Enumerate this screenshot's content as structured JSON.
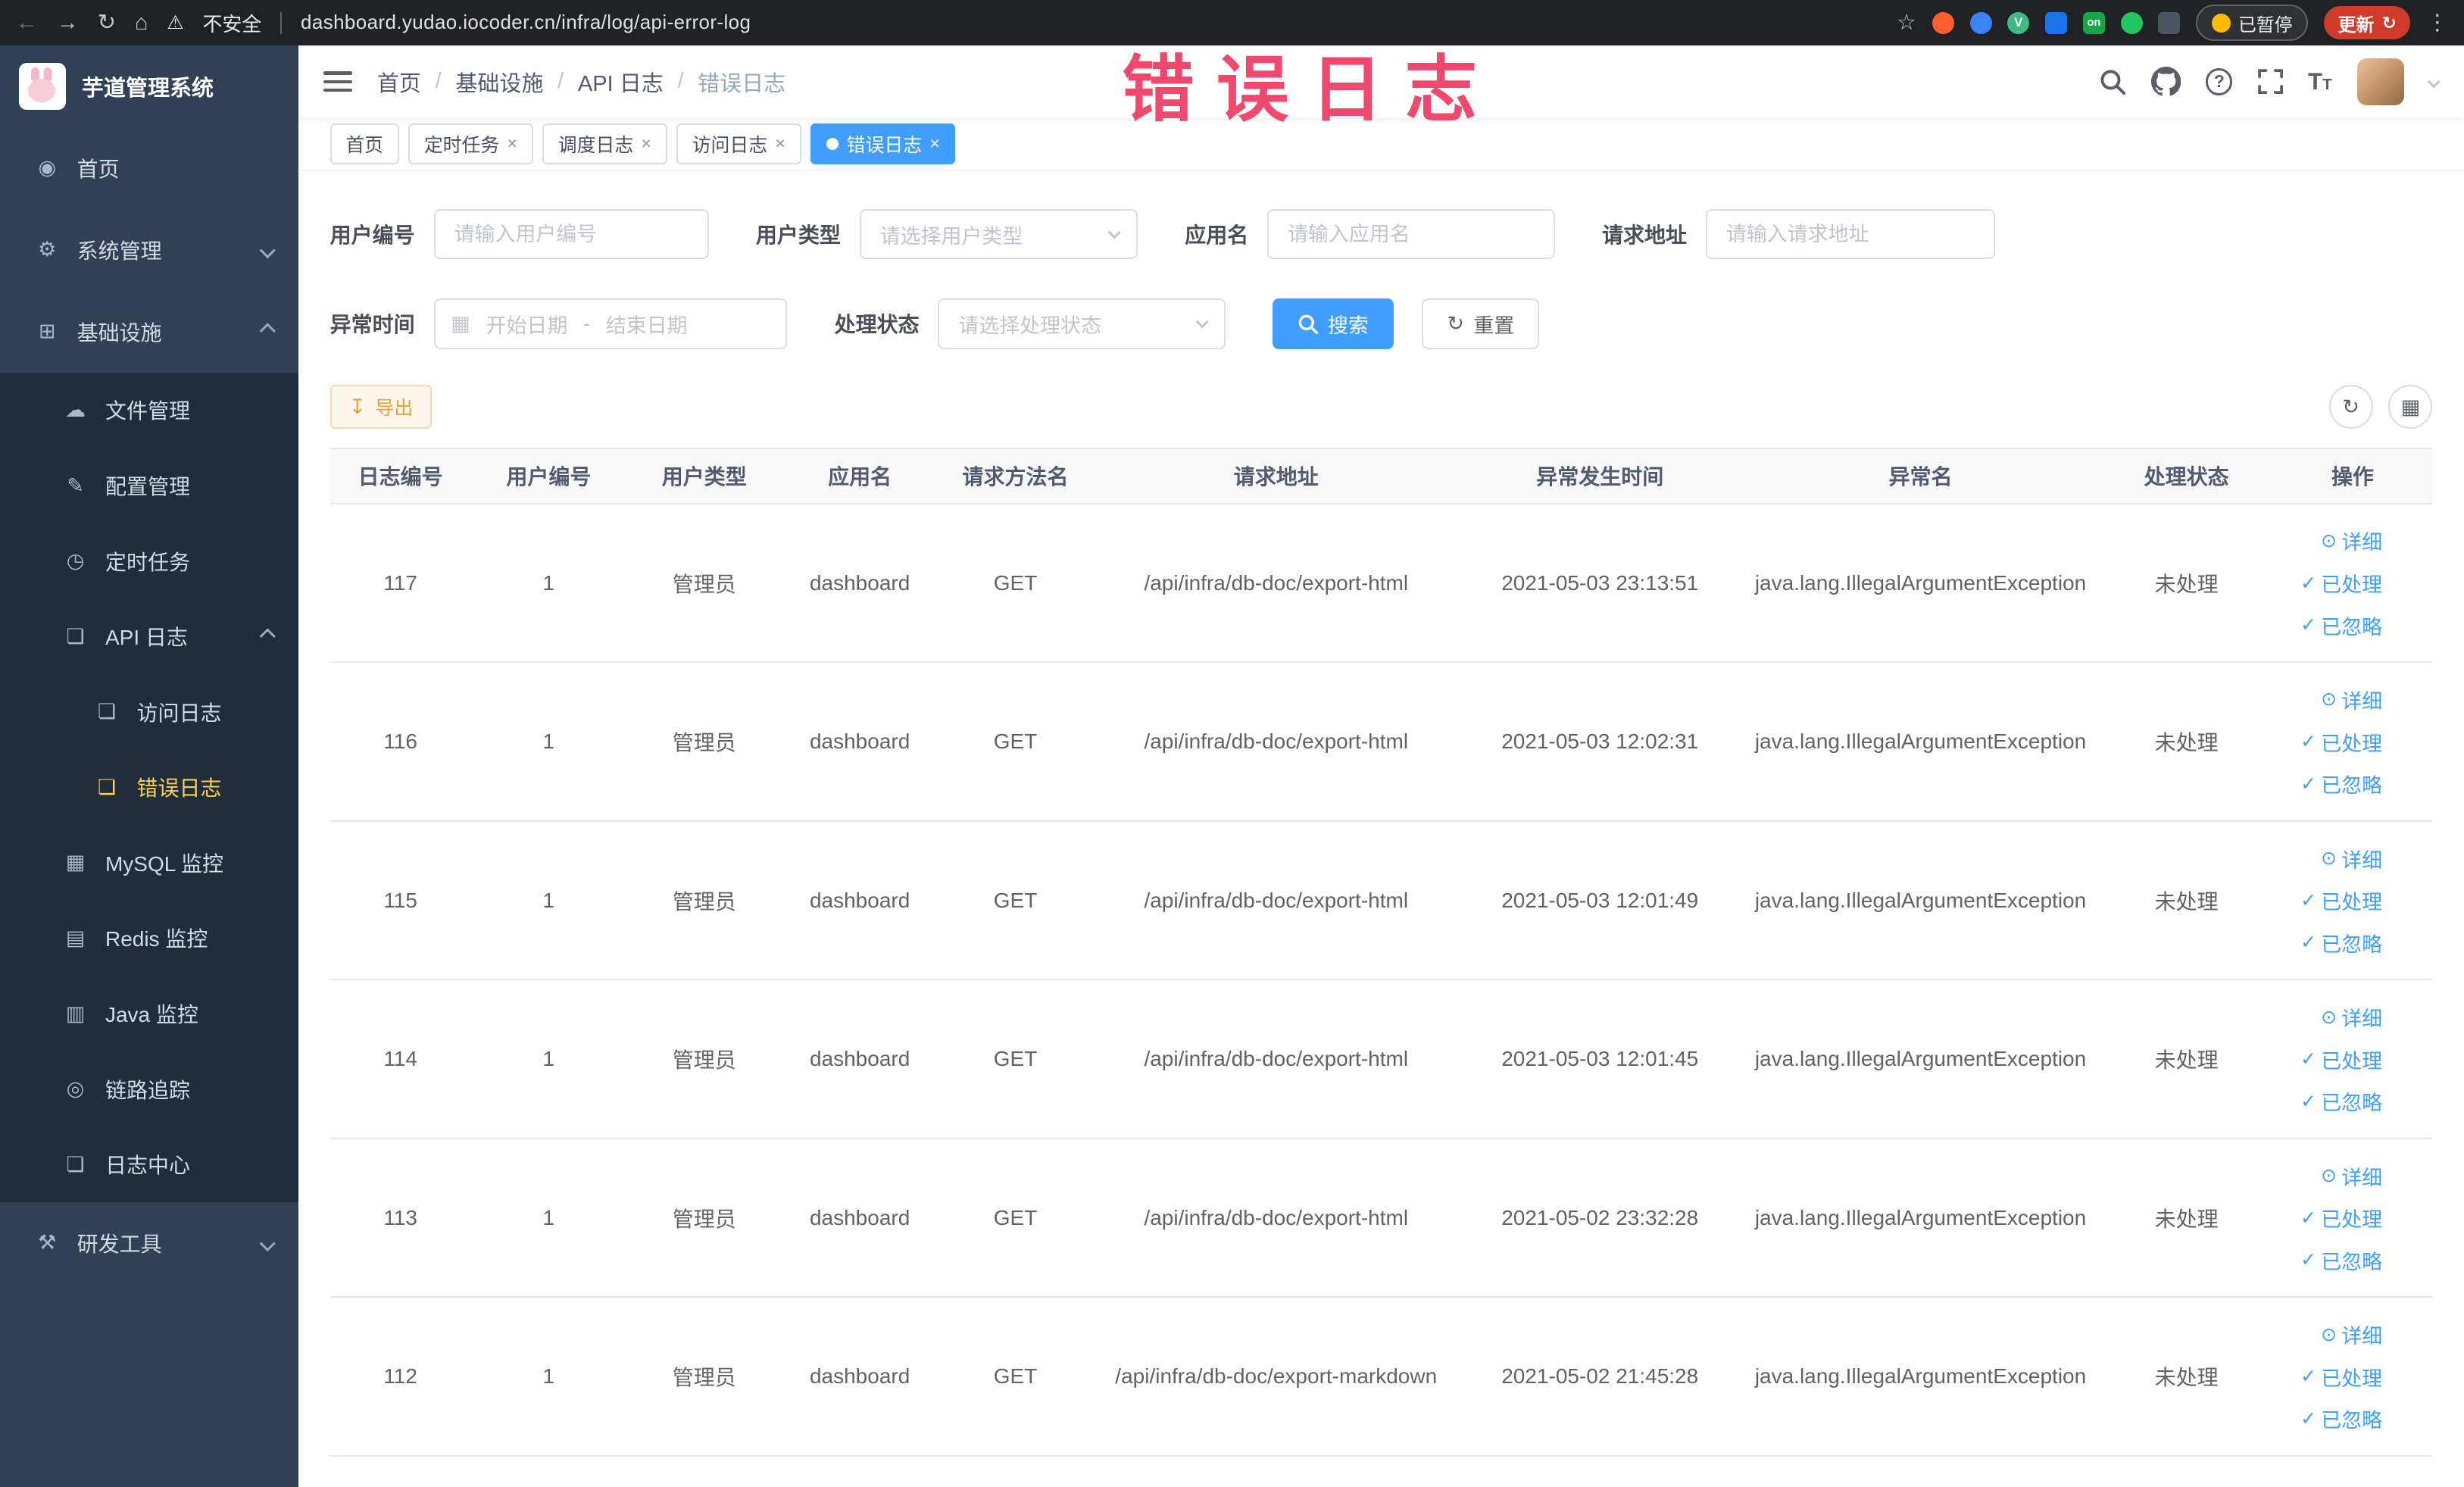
{
  "browser": {
    "security_label": "不安全",
    "url": "dashboard.yudao.iocoder.cn/infra/log/api-error-log",
    "paused_label": "已暂停",
    "update_label": "更新"
  },
  "watermark": "错误日志",
  "sidebar": {
    "logo_title": "芋道管理系统",
    "menu": {
      "home": "首页",
      "system": "系统管理",
      "infra": "基础设施",
      "file": "文件管理",
      "config": "配置管理",
      "job": "定时任务",
      "api_log": "API 日志",
      "access_log": "访问日志",
      "error_log": "错误日志",
      "mysql": "MySQL 监控",
      "redis": "Redis 监控",
      "java": "Java 监控",
      "trace": "链路追踪",
      "log_center": "日志中心",
      "dev_tools": "研发工具"
    }
  },
  "header": {
    "breadcrumb": [
      "首页",
      "基础设施",
      "API 日志",
      "错误日志"
    ]
  },
  "tabs": [
    "首页",
    "定时任务",
    "调度日志",
    "访问日志",
    "错误日志"
  ],
  "filters": {
    "user_id": {
      "label": "用户编号",
      "placeholder": "请输入用户编号"
    },
    "user_type": {
      "label": "用户类型",
      "placeholder": "请选择用户类型"
    },
    "app_name": {
      "label": "应用名",
      "placeholder": "请输入应用名"
    },
    "request_url": {
      "label": "请求地址",
      "placeholder": "请输入请求地址"
    },
    "exception_time": {
      "label": "异常时间",
      "start_placeholder": "开始日期",
      "separator": "-",
      "end_placeholder": "结束日期"
    },
    "process_status": {
      "label": "处理状态",
      "placeholder": "请选择处理状态"
    },
    "search_label": "搜索",
    "reset_label": "重置"
  },
  "toolbar": {
    "export_label": "导出"
  },
  "table": {
    "columns": [
      "日志编号",
      "用户编号",
      "用户类型",
      "应用名",
      "请求方法名",
      "请求地址",
      "异常发生时间",
      "异常名",
      "处理状态",
      "操作"
    ],
    "actions": {
      "detail": "详细",
      "processed": "已处理",
      "ignored": "已忽略"
    },
    "rows": [
      {
        "id": "117",
        "user_id": "1",
        "user_type": "管理员",
        "app": "dashboard",
        "method": "GET",
        "url": "/api/infra/db-doc/export-html",
        "time": "2021-05-03 23:13:51",
        "exception": "java.lang.IllegalArgumentException",
        "status": "未处理"
      },
      {
        "id": "116",
        "user_id": "1",
        "user_type": "管理员",
        "app": "dashboard",
        "method": "GET",
        "url": "/api/infra/db-doc/export-html",
        "time": "2021-05-03 12:02:31",
        "exception": "java.lang.IllegalArgumentException",
        "status": "未处理"
      },
      {
        "id": "115",
        "user_id": "1",
        "user_type": "管理员",
        "app": "dashboard",
        "method": "GET",
        "url": "/api/infra/db-doc/export-html",
        "time": "2021-05-03 12:01:49",
        "exception": "java.lang.IllegalArgumentException",
        "status": "未处理"
      },
      {
        "id": "114",
        "user_id": "1",
        "user_type": "管理员",
        "app": "dashboard",
        "method": "GET",
        "url": "/api/infra/db-doc/export-html",
        "time": "2021-05-03 12:01:45",
        "exception": "java.lang.IllegalArgumentException",
        "status": "未处理"
      },
      {
        "id": "113",
        "user_id": "1",
        "user_type": "管理员",
        "app": "dashboard",
        "method": "GET",
        "url": "/api/infra/db-doc/export-html",
        "time": "2021-05-02 23:32:28",
        "exception": "java.lang.IllegalArgumentException",
        "status": "未处理"
      },
      {
        "id": "112",
        "user_id": "1",
        "user_type": "管理员",
        "app": "dashboard",
        "method": "GET",
        "url": "/api/infra/db-doc/export-markdown",
        "time": "2021-05-02 21:45:28",
        "exception": "java.lang.IllegalArgumentException",
        "status": "未处理"
      }
    ]
  }
}
